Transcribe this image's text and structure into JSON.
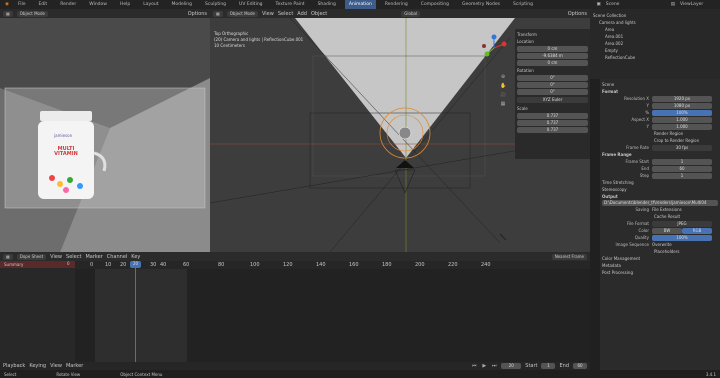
{
  "menu": [
    "File",
    "Edit",
    "Render",
    "Window",
    "Help"
  ],
  "workspace_tabs": [
    "Layout",
    "Modeling",
    "Sculpting",
    "UV Editing",
    "Texture Paint",
    "Shading",
    "Animation",
    "Rendering",
    "Compositing",
    "Geometry Nodes",
    "Scripting"
  ],
  "active_tab": "Animation",
  "scene_label": "Scene",
  "view_layer_label": "ViewLayer",
  "left_view": {
    "mode": "Object Mode",
    "options": "Options",
    "product_brand": "jamieson",
    "product_text": "MULTI VITAMIN"
  },
  "viewport": {
    "mode": "Object Mode",
    "menu": [
      "View",
      "Select",
      "Add",
      "Object"
    ],
    "orient": "Global",
    "options": "Options",
    "info": [
      "Top Orthographic",
      "(20) Camera and lights | ReflectionCube.001",
      "10 Centimeters"
    ]
  },
  "transform": {
    "title": "Transform",
    "location_label": "Location",
    "location": [
      "0 cm",
      "-9.6384 m",
      "0 cm"
    ],
    "rotation_label": "Rotation",
    "rotation": [
      "0°",
      "0°",
      "0°"
    ],
    "rotation_mode": "XYZ Euler",
    "scale_label": "Scale",
    "scale": [
      "0.737",
      "0.737",
      "0.737"
    ]
  },
  "outliner": {
    "items": [
      "Scene Collection",
      "Camera and lights",
      "Area",
      "Area.001",
      "Area.002",
      "Empty",
      "ReflectionCube"
    ]
  },
  "properties": {
    "scene": "Scene",
    "format": "Format",
    "res_x_label": "Resolution X",
    "res_x": "1920 px",
    "res_y_label": "Y",
    "res_y": "1080 px",
    "pct_label": "%",
    "pct": "100%",
    "aspect_x_label": "Aspect X",
    "aspect_x": "1.000",
    "aspect_y_label": "Y",
    "aspect_y": "1.000",
    "render_region": "Render Region",
    "crop": "Crop to Render Region",
    "frame_rate_label": "Frame Rate",
    "frame_rate": "30 fps",
    "frame_range": "Frame Range",
    "frame_start_label": "Frame Start",
    "frame_start": "1",
    "end_label": "End",
    "end": "60",
    "step_label": "Step",
    "step": "1",
    "time_stretching": "Time Stretching",
    "stereoscopy": "Stereoscopy",
    "output": "Output",
    "path": "D:\\Documents\\blender_tf\\renders\\jamieson\\Multi04",
    "saving_label": "Saving",
    "file_ext": "File Extensions",
    "cache_result": "Cache Result",
    "file_format_label": "File Format",
    "file_format": "JPEG",
    "color_label": "Color",
    "bw": "BW",
    "rgb": "RGB",
    "quality_label": "Quality",
    "quality": "100%",
    "image_seq_label": "Image Sequence",
    "overwrite": "Overwrite",
    "placeholders": "Placeholders",
    "color_mgmt": "Color Management",
    "metadata": "Metadata",
    "post": "Post Processing"
  },
  "dopesheet": {
    "mode": "Dope Sheet",
    "menu": [
      "View",
      "Select",
      "Marker",
      "Channel",
      "Key"
    ],
    "summary": "Summary",
    "nearest": "Nearest Frame",
    "current": "20",
    "ticks": [
      "0",
      "20",
      "40",
      "60",
      "80",
      "100",
      "120",
      "140",
      "160",
      "180",
      "200",
      "220",
      "240"
    ],
    "small_ticks": [
      "10",
      "30"
    ]
  },
  "timeline": {
    "playback": "Playback",
    "keying": "Keying",
    "menu": [
      "View",
      "Marker"
    ],
    "frame": "20",
    "start_label": "Start",
    "start": "1",
    "end_label": "End",
    "end": "60"
  },
  "status": {
    "select": "Select",
    "rotate": "Rotate View",
    "context": "Object Context Menu",
    "version": "3.4.1"
  }
}
